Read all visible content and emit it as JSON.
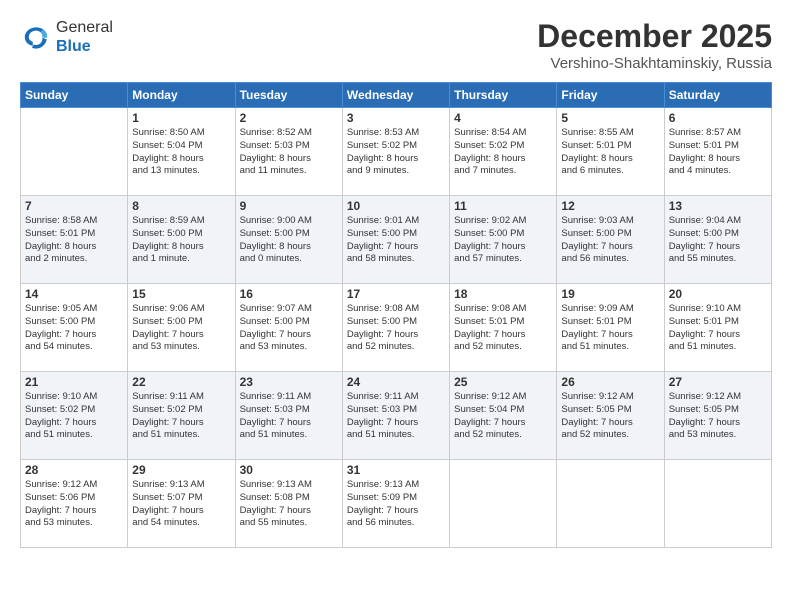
{
  "header": {
    "logo_line1": "General",
    "logo_line2": "Blue",
    "month": "December 2025",
    "location": "Vershino-Shakhtaminskiy, Russia"
  },
  "weekdays": [
    "Sunday",
    "Monday",
    "Tuesday",
    "Wednesday",
    "Thursday",
    "Friday",
    "Saturday"
  ],
  "weeks": [
    [
      {
        "day": "",
        "info": ""
      },
      {
        "day": "1",
        "info": "Sunrise: 8:50 AM\nSunset: 5:04 PM\nDaylight: 8 hours\nand 13 minutes."
      },
      {
        "day": "2",
        "info": "Sunrise: 8:52 AM\nSunset: 5:03 PM\nDaylight: 8 hours\nand 11 minutes."
      },
      {
        "day": "3",
        "info": "Sunrise: 8:53 AM\nSunset: 5:02 PM\nDaylight: 8 hours\nand 9 minutes."
      },
      {
        "day": "4",
        "info": "Sunrise: 8:54 AM\nSunset: 5:02 PM\nDaylight: 8 hours\nand 7 minutes."
      },
      {
        "day": "5",
        "info": "Sunrise: 8:55 AM\nSunset: 5:01 PM\nDaylight: 8 hours\nand 6 minutes."
      },
      {
        "day": "6",
        "info": "Sunrise: 8:57 AM\nSunset: 5:01 PM\nDaylight: 8 hours\nand 4 minutes."
      }
    ],
    [
      {
        "day": "7",
        "info": "Sunrise: 8:58 AM\nSunset: 5:01 PM\nDaylight: 8 hours\nand 2 minutes."
      },
      {
        "day": "8",
        "info": "Sunrise: 8:59 AM\nSunset: 5:00 PM\nDaylight: 8 hours\nand 1 minute."
      },
      {
        "day": "9",
        "info": "Sunrise: 9:00 AM\nSunset: 5:00 PM\nDaylight: 8 hours\nand 0 minutes."
      },
      {
        "day": "10",
        "info": "Sunrise: 9:01 AM\nSunset: 5:00 PM\nDaylight: 7 hours\nand 58 minutes."
      },
      {
        "day": "11",
        "info": "Sunrise: 9:02 AM\nSunset: 5:00 PM\nDaylight: 7 hours\nand 57 minutes."
      },
      {
        "day": "12",
        "info": "Sunrise: 9:03 AM\nSunset: 5:00 PM\nDaylight: 7 hours\nand 56 minutes."
      },
      {
        "day": "13",
        "info": "Sunrise: 9:04 AM\nSunset: 5:00 PM\nDaylight: 7 hours\nand 55 minutes."
      }
    ],
    [
      {
        "day": "14",
        "info": "Sunrise: 9:05 AM\nSunset: 5:00 PM\nDaylight: 7 hours\nand 54 minutes."
      },
      {
        "day": "15",
        "info": "Sunrise: 9:06 AM\nSunset: 5:00 PM\nDaylight: 7 hours\nand 53 minutes."
      },
      {
        "day": "16",
        "info": "Sunrise: 9:07 AM\nSunset: 5:00 PM\nDaylight: 7 hours\nand 53 minutes."
      },
      {
        "day": "17",
        "info": "Sunrise: 9:08 AM\nSunset: 5:00 PM\nDaylight: 7 hours\nand 52 minutes."
      },
      {
        "day": "18",
        "info": "Sunrise: 9:08 AM\nSunset: 5:01 PM\nDaylight: 7 hours\nand 52 minutes."
      },
      {
        "day": "19",
        "info": "Sunrise: 9:09 AM\nSunset: 5:01 PM\nDaylight: 7 hours\nand 51 minutes."
      },
      {
        "day": "20",
        "info": "Sunrise: 9:10 AM\nSunset: 5:01 PM\nDaylight: 7 hours\nand 51 minutes."
      }
    ],
    [
      {
        "day": "21",
        "info": "Sunrise: 9:10 AM\nSunset: 5:02 PM\nDaylight: 7 hours\nand 51 minutes."
      },
      {
        "day": "22",
        "info": "Sunrise: 9:11 AM\nSunset: 5:02 PM\nDaylight: 7 hours\nand 51 minutes."
      },
      {
        "day": "23",
        "info": "Sunrise: 9:11 AM\nSunset: 5:03 PM\nDaylight: 7 hours\nand 51 minutes."
      },
      {
        "day": "24",
        "info": "Sunrise: 9:11 AM\nSunset: 5:03 PM\nDaylight: 7 hours\nand 51 minutes."
      },
      {
        "day": "25",
        "info": "Sunrise: 9:12 AM\nSunset: 5:04 PM\nDaylight: 7 hours\nand 52 minutes."
      },
      {
        "day": "26",
        "info": "Sunrise: 9:12 AM\nSunset: 5:05 PM\nDaylight: 7 hours\nand 52 minutes."
      },
      {
        "day": "27",
        "info": "Sunrise: 9:12 AM\nSunset: 5:05 PM\nDaylight: 7 hours\nand 53 minutes."
      }
    ],
    [
      {
        "day": "28",
        "info": "Sunrise: 9:12 AM\nSunset: 5:06 PM\nDaylight: 7 hours\nand 53 minutes."
      },
      {
        "day": "29",
        "info": "Sunrise: 9:13 AM\nSunset: 5:07 PM\nDaylight: 7 hours\nand 54 minutes."
      },
      {
        "day": "30",
        "info": "Sunrise: 9:13 AM\nSunset: 5:08 PM\nDaylight: 7 hours\nand 55 minutes."
      },
      {
        "day": "31",
        "info": "Sunrise: 9:13 AM\nSunset: 5:09 PM\nDaylight: 7 hours\nand 56 minutes."
      },
      {
        "day": "",
        "info": ""
      },
      {
        "day": "",
        "info": ""
      },
      {
        "day": "",
        "info": ""
      }
    ]
  ]
}
